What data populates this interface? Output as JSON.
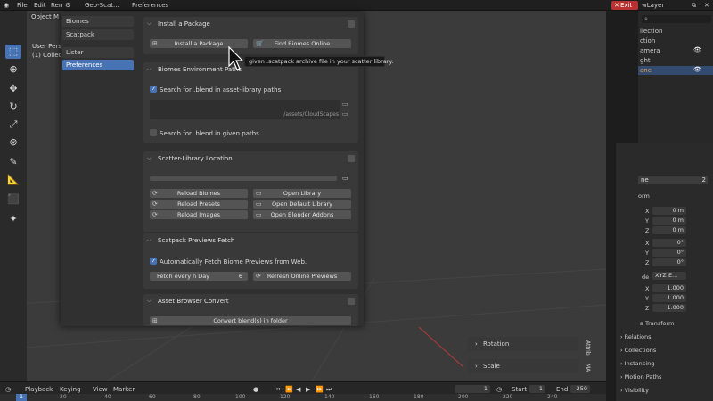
{
  "menubar": {
    "file": "File",
    "edit": "Edit",
    "render": "Ren",
    "geoscatter": "Geo-Scat...",
    "preferences": "Preferences",
    "exit": "Exit",
    "layer": "wLayer"
  },
  "viewport": {
    "object_mode": "Object M",
    "user_pers": "User Pers",
    "collection": "(1) Collec"
  },
  "nav": {
    "items": [
      "Biomes",
      "Scatpack",
      "Lister",
      "Preferences"
    ],
    "active": "Preferences"
  },
  "install": {
    "title": "Install a Package",
    "install_btn": "Install a Package",
    "find_btn": "Find Biomes Online",
    "tooltip": "given .scatpack archive file in your scatter library."
  },
  "env_paths": {
    "title": "Biomes Environment Paths",
    "search_asset": "Search for .blend in asset-library paths",
    "path_text": "/assets/CloudScapes",
    "search_given": "Search for .blend in given paths"
  },
  "library": {
    "title": "Scatter-Library Location",
    "reload_biomes": "Reload Biomes",
    "reload_presets": "Reload Presets",
    "reload_images": "Reload Images",
    "open_library": "Open Library",
    "open_default": "Open Default Library",
    "open_addons": "Open Blender Addons"
  },
  "previews": {
    "title": "Scatpack Previews Fetch",
    "auto_fetch": "Automatically Fetch Biome Previews from Web.",
    "fetch_every": "Fetch every n Day",
    "fetch_value": "6",
    "refresh": "Refresh Online Previews"
  },
  "convert": {
    "title": "Asset Browser Convert",
    "convert_btn": "Convert blend(s) in folder"
  },
  "outliner": {
    "collection": "llection",
    "rows": [
      "ction",
      "amera",
      "ght",
      "ane"
    ]
  },
  "props": {
    "name": "ne",
    "users": "2",
    "transform": "orm",
    "loc": {
      "x": "0 m",
      "y": "0 m",
      "z": "0 m"
    },
    "rot": {
      "x": "0°",
      "y": "0°",
      "z": "0°"
    },
    "mode_label": "de",
    "mode_value": "XYZ E...",
    "scale": {
      "x": "1.000",
      "y": "1.000",
      "z": "1.000"
    },
    "delta": "a Transform",
    "sections": [
      "Relations",
      "Collections",
      "Instancing",
      "Motion Paths",
      "Visibility"
    ],
    "axis_labels": [
      "X",
      "Y",
      "Z"
    ]
  },
  "side_panels": {
    "rotation": "Rotation",
    "scale": "Scale",
    "tab1": "Attrib",
    "tab2": "MA"
  },
  "timeline": {
    "playback": "Playback",
    "keying": "Keying",
    "view": "View",
    "marker": "Marker",
    "current": "1",
    "start_label": "Start",
    "start": "1",
    "end_label": "End",
    "end": "250",
    "ruler": [
      "1",
      "20",
      "40",
      "60",
      "80",
      "100",
      "120",
      "140",
      "160",
      "180",
      "200",
      "220",
      "240"
    ]
  },
  "colors": {
    "accent": "#4772b3",
    "exit": "#b93131",
    "panel": "#393939",
    "window": "#303030"
  }
}
